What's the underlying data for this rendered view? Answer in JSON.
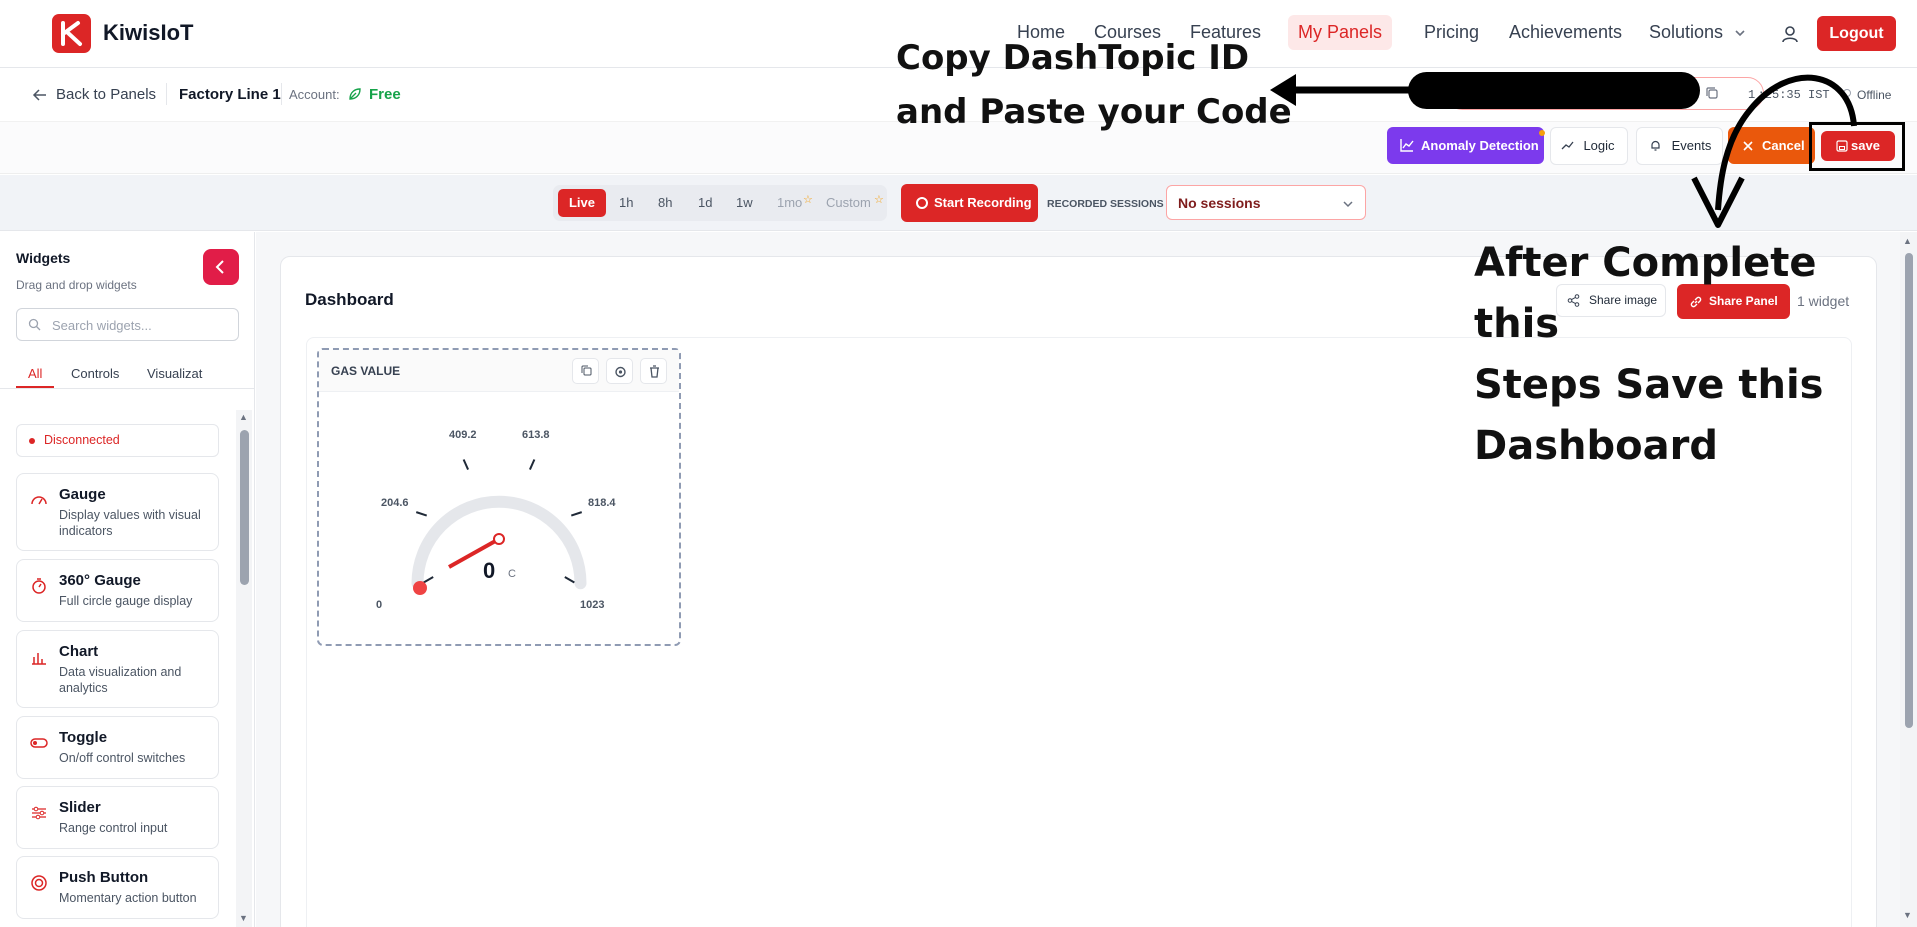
{
  "app": {
    "brand": "KiwisIoT"
  },
  "nav": {
    "home": "Home",
    "courses": "Courses",
    "features": "Features",
    "my_panels": "My Panels",
    "pricing": "Pricing",
    "achievements": "Achievements",
    "solutions": "Solutions",
    "logout": "Logout"
  },
  "subbar": {
    "back": "Back to Panels",
    "panel_name": "Factory Line 1",
    "account_label": "Account:",
    "plan": "Free",
    "time": "1 :25:35 IST",
    "status": "Offline"
  },
  "actions": {
    "anomaly": "Anomaly Detection",
    "logic": "Logic",
    "events": "Events",
    "cancel": "Cancel",
    "save": "save"
  },
  "ranges": {
    "live": "Live",
    "h1": "1h",
    "h8": "8h",
    "d1": "1d",
    "w1": "1w",
    "mo1": "1mo",
    "custom": "Custom",
    "start_recording": "Start Recording",
    "recorded_label": "RECORDED SESSIONS",
    "sessions_value": "No sessions"
  },
  "sidebar": {
    "title": "Widgets",
    "subtitle": "Drag and drop widgets",
    "search_placeholder": "Search widgets...",
    "tabs": [
      "All",
      "Controls",
      "Visualizat"
    ],
    "status": "Disconnected",
    "items": [
      {
        "title": "Gauge",
        "desc": "Display values with visual indicators",
        "icon": "gauge-icon"
      },
      {
        "title": "360° Gauge",
        "desc": "Full circle gauge display",
        "icon": "timer-icon"
      },
      {
        "title": "Chart",
        "desc": "Data visualization and analytics",
        "icon": "bar-chart-icon"
      },
      {
        "title": "Toggle",
        "desc": "On/off control switches",
        "icon": "toggle-icon"
      },
      {
        "title": "Slider",
        "desc": "Range control input",
        "icon": "sliders-icon"
      },
      {
        "title": "Push Button",
        "desc": "Momentary action button",
        "icon": "target-icon"
      }
    ]
  },
  "dashboard": {
    "title": "Dashboard",
    "share_image": "Share image",
    "share_panel": "Share Panel",
    "widget_count": "1 widget"
  },
  "gauge_widget": {
    "title": "GAS VALUE",
    "value": "0",
    "unit": "C",
    "min": 0,
    "max": 1023,
    "ticks": [
      "0",
      "204.6",
      "409.2",
      "613.8",
      "818.4",
      "1023"
    ]
  },
  "annotations": {
    "copy_line1": "Copy DashTopic ID",
    "copy_line2": "and Paste your Code",
    "save_line1": "After Complete this",
    "save_line2": "Steps Save this",
    "save_line3": "Dashboard"
  },
  "colors": {
    "accent": "#dc2626",
    "purple": "#7c3aed",
    "orange": "#ea580c",
    "free": "#16a34a"
  }
}
